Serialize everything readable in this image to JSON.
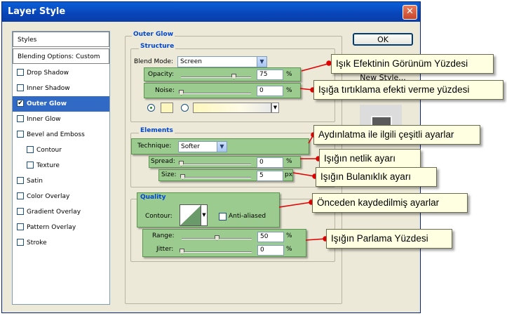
{
  "window": {
    "title": "Layer Style"
  },
  "styles_list": {
    "items": [
      {
        "label": "Styles",
        "checkbox": false,
        "checked": false
      },
      {
        "label": "Blending Options: Custom",
        "checkbox": false,
        "checked": false
      },
      {
        "label": "Drop Shadow",
        "checkbox": true,
        "checked": false
      },
      {
        "label": "Inner Shadow",
        "checkbox": true,
        "checked": false
      },
      {
        "label": "Outer Glow",
        "checkbox": true,
        "checked": true,
        "selected": true
      },
      {
        "label": "Inner Glow",
        "checkbox": true,
        "checked": false
      },
      {
        "label": "Bevel and Emboss",
        "checkbox": true,
        "checked": false
      },
      {
        "label": "Contour",
        "checkbox": true,
        "checked": false
      },
      {
        "label": "Texture",
        "checkbox": true,
        "checked": false
      },
      {
        "label": "Satin",
        "checkbox": true,
        "checked": false
      },
      {
        "label": "Color Overlay",
        "checkbox": true,
        "checked": false
      },
      {
        "label": "Gradient Overlay",
        "checkbox": true,
        "checked": false
      },
      {
        "label": "Pattern Overlay",
        "checkbox": true,
        "checked": false
      },
      {
        "label": "Stroke",
        "checkbox": true,
        "checked": false
      }
    ]
  },
  "outer_glow": {
    "title": "Outer Glow",
    "structure": {
      "title": "Structure",
      "blend_mode_label": "Blend Mode:",
      "blend_mode_value": "Screen",
      "opacity_label": "Opacity:",
      "opacity_value": "75",
      "opacity_unit": "%",
      "opacity_fraction": 0.75,
      "noise_label": "Noise:",
      "noise_value": "0",
      "noise_unit": "%",
      "noise_fraction": 0,
      "glow_color": "#fef7bd"
    },
    "elements": {
      "title": "Elements",
      "technique_label": "Technique:",
      "technique_value": "Softer",
      "spread_label": "Spread:",
      "spread_value": "0",
      "spread_unit": "%",
      "spread_fraction": 0,
      "size_label": "Size:",
      "size_value": "5",
      "size_unit": "px",
      "size_fraction": 0.02
    },
    "quality": {
      "title": "Quality",
      "contour_label": "Contour:",
      "anti_aliased_label": "Anti-aliased",
      "range_label": "Range:",
      "range_value": "50",
      "range_unit": "%",
      "range_fraction": 0.5,
      "jitter_label": "Jitter:",
      "jitter_value": "0",
      "jitter_unit": "%",
      "jitter_fraction": 0
    }
  },
  "buttons": {
    "ok": "OK",
    "new_style": "New Style..."
  },
  "callouts": {
    "opacity": "Işık Efektinin Görünüm Yüzdesi",
    "noise": "Işığa tırtıklama efekti verme yüzdesi",
    "elements": "Aydınlatma ile ilgili çeşitli ayarlar",
    "spread": "Işığın netlik ayarı",
    "size": "Işığın Bulanıklık ayarı",
    "contour": "Önceden kaydedilmiş ayarlar",
    "range": "Işığın Parlama Yüzdesi"
  },
  "colors": {
    "highlight": "#9ccb8f",
    "callout_bg": "#ffffe1",
    "arrow": "#e00000",
    "title_blue": "#0046d5"
  }
}
